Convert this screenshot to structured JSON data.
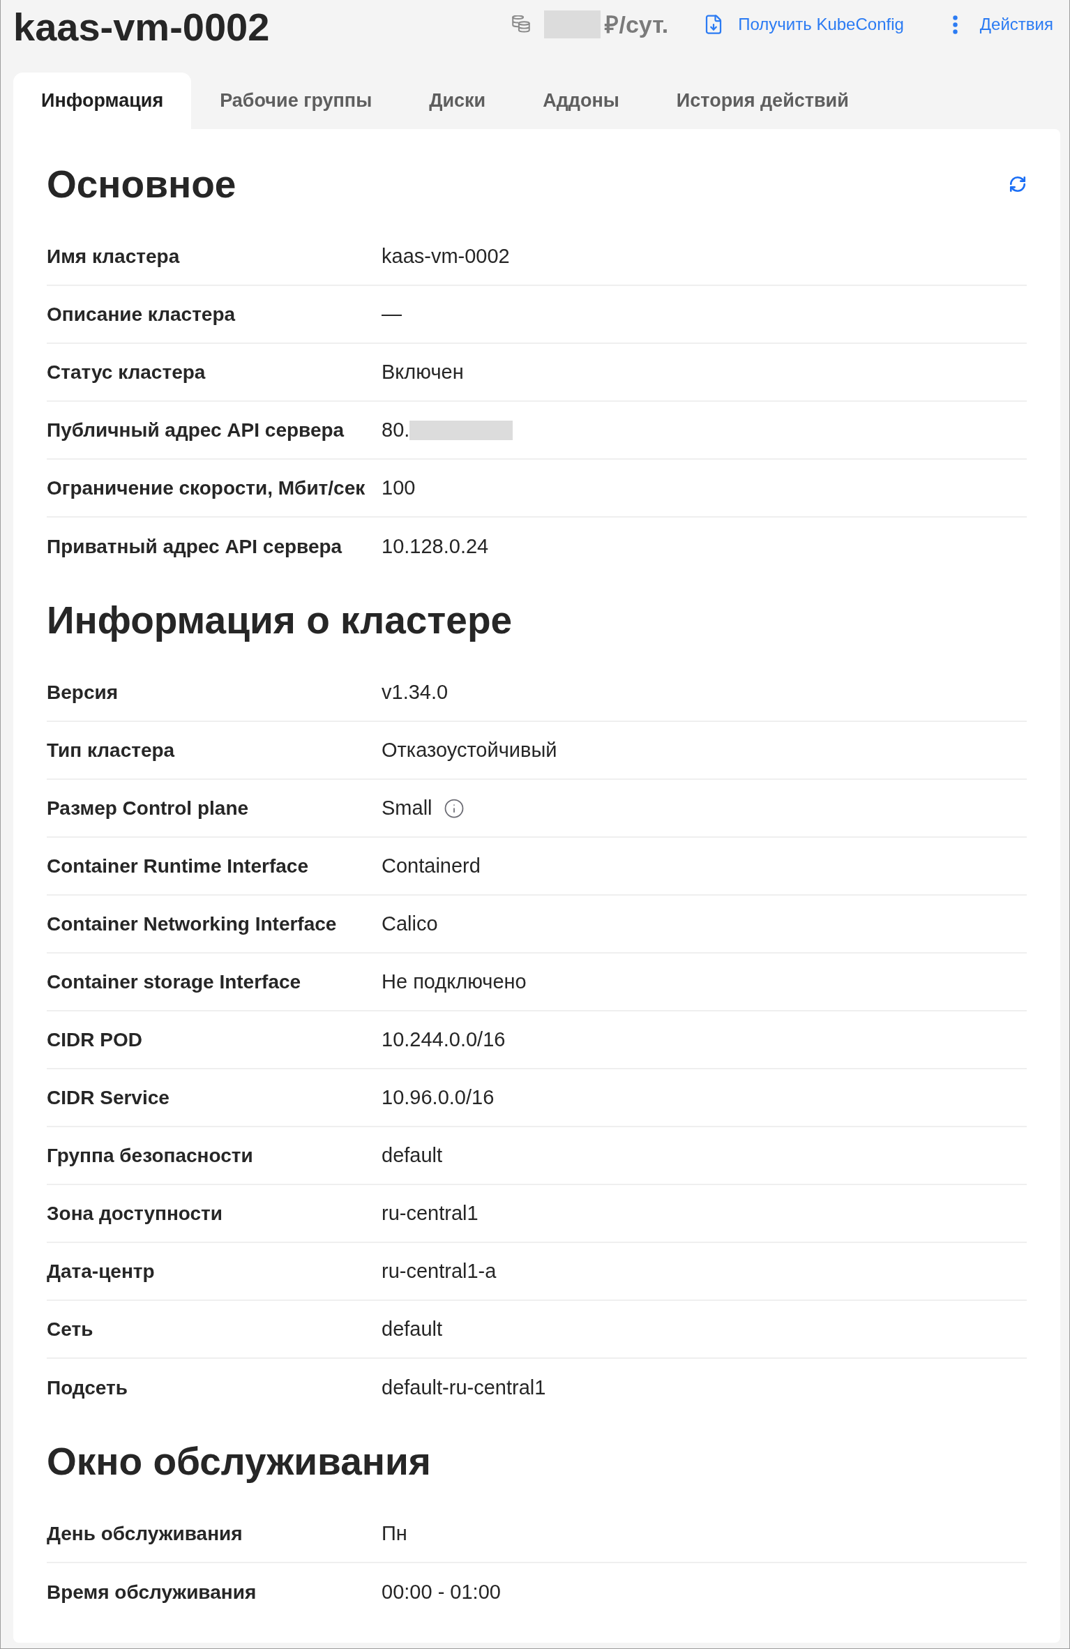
{
  "header": {
    "title": "kaas-vm-0002",
    "price": {
      "masked": true,
      "unit": "₽/сут."
    },
    "actions": [
      {
        "kind": "download",
        "label": "Получить KubeConfig"
      },
      {
        "kind": "menu",
        "label": "Действия"
      }
    ]
  },
  "tabs": [
    {
      "label": "Информация",
      "selected": true
    },
    {
      "label": "Рабочие группы",
      "selected": false
    },
    {
      "label": "Диски",
      "selected": false
    },
    {
      "label": "Аддоны",
      "selected": false
    },
    {
      "label": "История действий",
      "selected": false
    }
  ],
  "sections": [
    {
      "title": "Основное",
      "refresh": true,
      "rows": [
        {
          "kind": "plain",
          "label": "Имя кластера",
          "value": "kaas-vm-0002"
        },
        {
          "kind": "plain",
          "label": "Описание кластера",
          "value": "—"
        },
        {
          "kind": "plain",
          "label": "Статус кластера",
          "value": "Включен"
        },
        {
          "kind": "masked",
          "label": "Публичный адрес API сервера",
          "value": "80."
        },
        {
          "kind": "plain",
          "label": "Ограничение скорости, Мбит/сек",
          "value": "100"
        },
        {
          "kind": "plain",
          "label": "Приватный адрес API сервера",
          "value": "10.128.0.24"
        }
      ]
    },
    {
      "title": "Информация о кластере",
      "refresh": false,
      "rows": [
        {
          "kind": "plain",
          "label": "Версия",
          "value": "v1.34.0"
        },
        {
          "kind": "plain",
          "label": "Тип кластера",
          "value": "Отказоустойчивый"
        },
        {
          "kind": "info",
          "label": "Размер Control plane",
          "value": "Small"
        },
        {
          "kind": "plain",
          "label": "Container Runtime Interface",
          "value": "Containerd"
        },
        {
          "kind": "plain",
          "label": "Container Networking Interface",
          "value": "Calico"
        },
        {
          "kind": "plain",
          "label": "Container storage Interface",
          "value": "Не подключено"
        },
        {
          "kind": "plain",
          "label": "CIDR POD",
          "value": "10.244.0.0/16"
        },
        {
          "kind": "plain",
          "label": "CIDR Service",
          "value": "10.96.0.0/16"
        },
        {
          "kind": "plain",
          "label": "Группа безопасности",
          "value": "default"
        },
        {
          "kind": "plain",
          "label": "Зона доступности",
          "value": "ru-central1"
        },
        {
          "kind": "plain",
          "label": "Дата-центр",
          "value": "ru-central1-a"
        },
        {
          "kind": "plain",
          "label": "Сеть",
          "value": "default"
        },
        {
          "kind": "plain",
          "label": "Подсеть",
          "value": "default-ru-central1"
        }
      ]
    },
    {
      "title": "Окно обслуживания",
      "refresh": false,
      "rows": [
        {
          "kind": "plain",
          "label": "День обслуживания",
          "value": "Пн"
        },
        {
          "kind": "plain",
          "label": "Время обслуживания",
          "value": "00:00 - 01:00"
        }
      ]
    }
  ]
}
